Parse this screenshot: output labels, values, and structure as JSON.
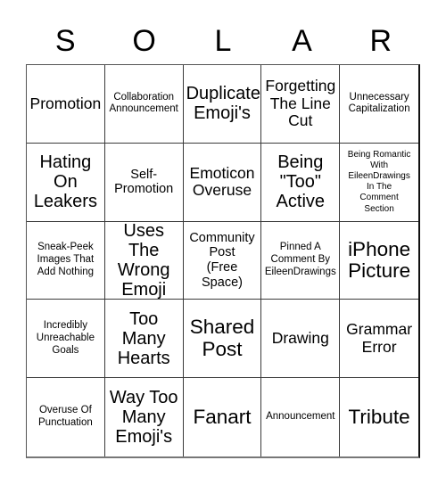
{
  "card": {
    "title_letters": [
      "S",
      "O",
      "L",
      "A",
      "R"
    ],
    "free_space_index": 12,
    "colors": {
      "text": "#000000",
      "background": "#ffffff",
      "grid_line": "#3a3a3a",
      "outer_border": "#111111"
    },
    "rows": [
      [
        {
          "text": "Promotion",
          "size": "fs-l"
        },
        {
          "text": "Collaboration\nAnnouncement",
          "size": "fs-s"
        },
        {
          "text": "Duplicate\nEmoji's",
          "size": "fs-xl"
        },
        {
          "text": "Forgetting\nThe Line\nCut",
          "size": "fs-l"
        },
        {
          "text": "Unnecessary\nCapitalization",
          "size": "fs-s"
        }
      ],
      [
        {
          "text": "Hating\nOn\nLeakers",
          "size": "fs-xl"
        },
        {
          "text": "Self-\nPromotion",
          "size": "fs-m"
        },
        {
          "text": "Emoticon\nOveruse",
          "size": "fs-l"
        },
        {
          "text": "Being\n\"Too\"\nActive",
          "size": "fs-xl"
        },
        {
          "text": "Being Romantic\nWith\nEileenDrawings\nIn The\nComment\nSection",
          "size": "fs-xs"
        }
      ],
      [
        {
          "text": "Sneak-Peek\nImages That\nAdd Nothing",
          "size": "fs-s"
        },
        {
          "text": "Uses The\nWrong\nEmoji",
          "size": "fs-xl"
        },
        {
          "text": "Community\nPost\n(Free\nSpace)",
          "size": "fs-m"
        },
        {
          "text": "Pinned A\nComment By\nEileenDrawings",
          "size": "fs-s"
        },
        {
          "text": "iPhone\nPicture",
          "size": "fs-xxl"
        }
      ],
      [
        {
          "text": "Incredibly\nUnreachable\nGoals",
          "size": "fs-s"
        },
        {
          "text": "Too\nMany\nHearts",
          "size": "fs-xl"
        },
        {
          "text": "Shared\nPost",
          "size": "fs-xxl"
        },
        {
          "text": "Drawing",
          "size": "fs-l"
        },
        {
          "text": "Grammar\nError",
          "size": "fs-l"
        }
      ],
      [
        {
          "text": "Overuse Of\nPunctuation",
          "size": "fs-s"
        },
        {
          "text": "Way Too\nMany\nEmoji's",
          "size": "fs-xl"
        },
        {
          "text": "Fanart",
          "size": "fs-xxl"
        },
        {
          "text": "Announcement",
          "size": "fs-s"
        },
        {
          "text": "Tribute",
          "size": "fs-xxl"
        }
      ]
    ]
  }
}
